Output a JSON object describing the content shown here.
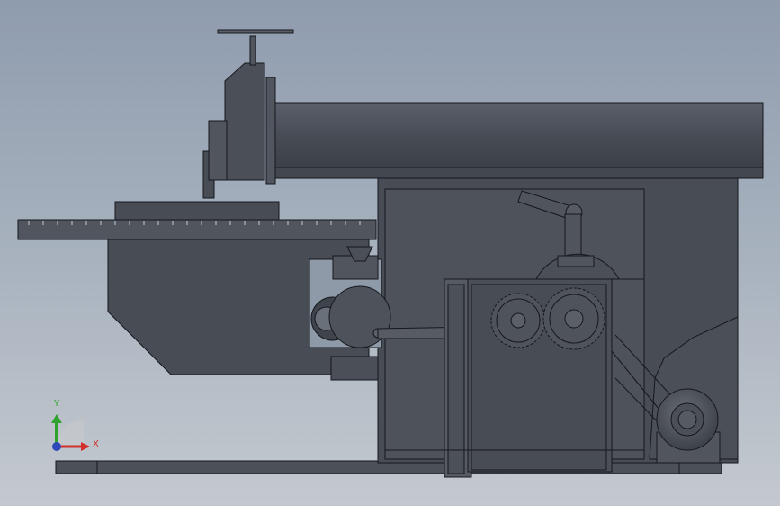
{
  "viewport": {
    "background_top": "#8f9cae",
    "background_bottom": "#c4c9cf"
  },
  "model": {
    "part_fill": "#474c55",
    "part_fill_light": "#555a63",
    "edge": "#16181c"
  },
  "triad": {
    "x_label": "X",
    "y_label": "Y",
    "x_color": "#d0312d",
    "y_color": "#2fa12f",
    "z_color": "#2d48b8",
    "icons": [
      "x-axis-arrow-icon",
      "y-axis-arrow-icon",
      "z-axis-dot-icon"
    ]
  }
}
